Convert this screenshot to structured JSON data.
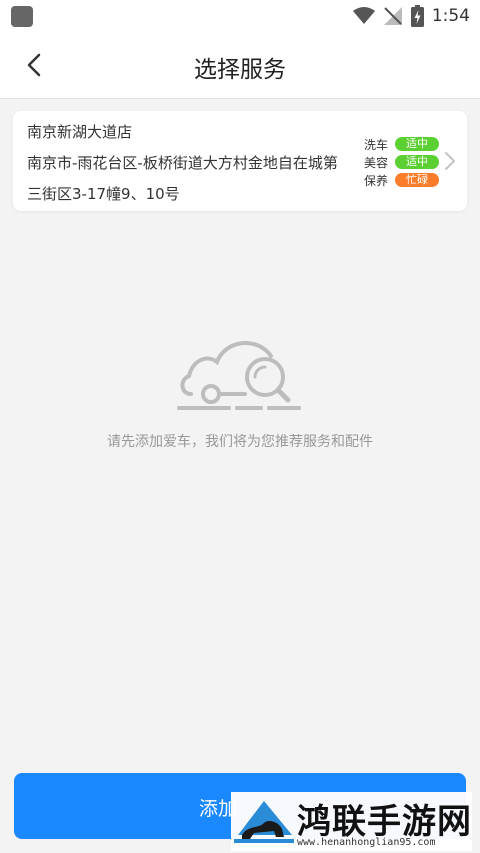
{
  "status_bar": {
    "time": "1:54"
  },
  "header": {
    "title": "选择服务"
  },
  "store": {
    "name": "南京新湖大道店",
    "address": "南京市-雨花台区-板桥街道大方村金地自在城第三街区3-17幢9、10号",
    "services": [
      {
        "name": "洗车",
        "status": "适中",
        "color": "#5ccf32"
      },
      {
        "name": "美容",
        "status": "适中",
        "color": "#5ccf32"
      },
      {
        "name": "保养",
        "status": "忙碌",
        "color": "#fb7d29"
      }
    ]
  },
  "empty_state": {
    "message": "请先添加爱车，我们将为您推荐服务和配件",
    "icon": "car-search-illustration"
  },
  "footer": {
    "add_car_label": "添加"
  },
  "watermark": {
    "name": "鸿联手游网",
    "url": "www.henanhonglian95.com"
  },
  "colors": {
    "primary": "#1a88ff",
    "moderate": "#5ccf32",
    "busy": "#fb7d29"
  }
}
